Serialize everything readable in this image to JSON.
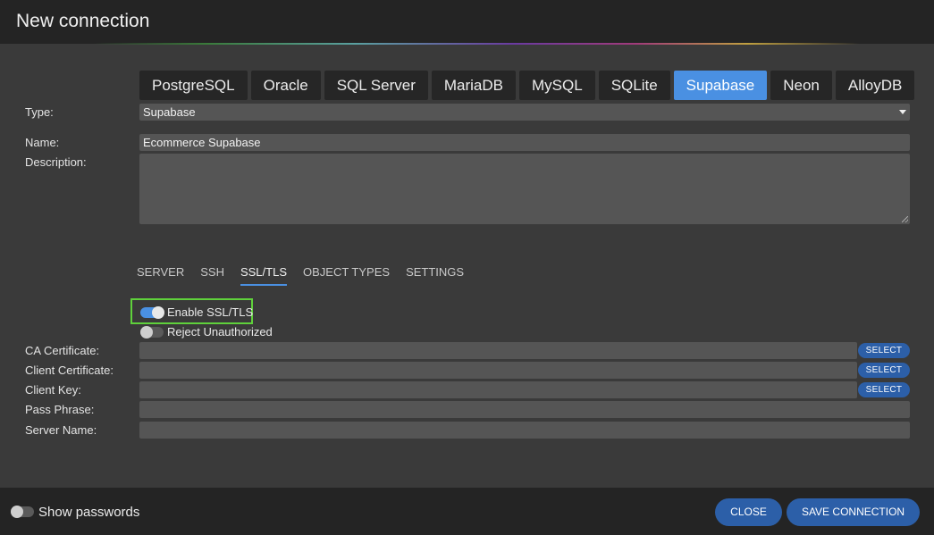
{
  "window": {
    "title": "New connection"
  },
  "db_tabs": [
    "PostgreSQL",
    "Oracle",
    "SQL Server",
    "MariaDB",
    "MySQL",
    "SQLite",
    "Supabase",
    "Neon",
    "AlloyDB"
  ],
  "active_db_tab": "Supabase",
  "form": {
    "type_label": "Type:",
    "type_value": "Supabase",
    "name_label": "Name:",
    "name_value": "Ecommerce Supabase",
    "description_label": "Description:",
    "description_value": ""
  },
  "sub_tabs": [
    "SERVER",
    "SSH",
    "SSL/TLS",
    "OBJECT TYPES",
    "SETTINGS"
  ],
  "active_sub_tab": "SSL/TLS",
  "ssl": {
    "enable_label": "Enable SSL/TLS",
    "enable_on": true,
    "reject_label": "Reject Unauthorized",
    "reject_on": false,
    "ca_label": "CA Certificate:",
    "ca_value": "",
    "client_cert_label": "Client Certificate:",
    "client_cert_value": "",
    "client_key_label": "Client Key:",
    "client_key_value": "",
    "pass_label": "Pass Phrase:",
    "pass_value": "",
    "server_name_label": "Server Name:",
    "server_name_value": "",
    "select_label": "SELECT"
  },
  "footer": {
    "show_passwords_label": "Show passwords",
    "show_passwords_on": false,
    "close_label": "CLOSE",
    "save_label": "SAVE CONNECTION"
  },
  "colors": {
    "accent": "#4a90e2",
    "button": "#2c5fa8",
    "highlight": "#5fd13b"
  }
}
